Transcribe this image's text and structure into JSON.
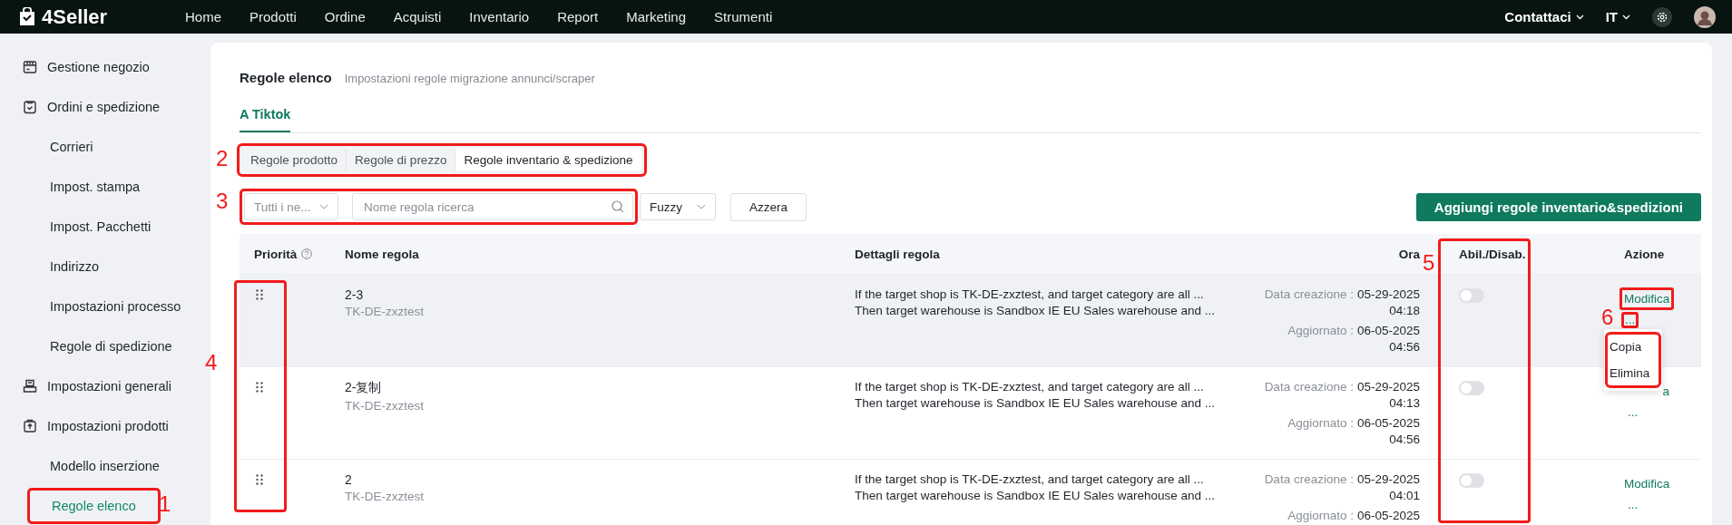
{
  "topbar": {
    "logo": "4Seller",
    "nav": [
      "Home",
      "Prodotti",
      "Ordine",
      "Acquisti",
      "Inventario",
      "Report",
      "Marketing",
      "Strumenti"
    ],
    "contact": "Contattaci",
    "language": "IT"
  },
  "sidebar": {
    "items": [
      {
        "label": "Gestione negozio",
        "kind": "section",
        "selected": false
      },
      {
        "label": "Ordini e spedizione",
        "kind": "section",
        "selected": false
      },
      {
        "label": "Corrieri",
        "kind": "link",
        "selected": false
      },
      {
        "label": "Impost. stampa",
        "kind": "link",
        "selected": false
      },
      {
        "label": "Impost. Pacchetti",
        "kind": "link",
        "selected": false
      },
      {
        "label": "Indirizzo",
        "kind": "link",
        "selected": false
      },
      {
        "label": "Impostazioni processo",
        "kind": "link",
        "selected": false
      },
      {
        "label": "Regole di spedizione",
        "kind": "link",
        "selected": false
      },
      {
        "label": "Impostazioni generali",
        "kind": "section",
        "selected": false
      },
      {
        "label": "Impostazioni prodotti",
        "kind": "section",
        "selected": false
      },
      {
        "label": "Modello inserzione",
        "kind": "link",
        "selected": false
      },
      {
        "label": "Regole elenco",
        "kind": "link",
        "selected": true,
        "annotation": "1"
      }
    ]
  },
  "page": {
    "title": "Regole elenco",
    "subtitle": "Impostazioni regole migrazione annunci/scraper"
  },
  "tabs": [
    {
      "label": "A Tiktok",
      "selected": true
    }
  ],
  "subtabs": {
    "annotation": "2",
    "items": [
      {
        "label": "Regole prodotto",
        "selected": false
      },
      {
        "label": "Regole di prezzo",
        "selected": false
      },
      {
        "label": "Regole inventario & spedizione",
        "selected": true
      }
    ]
  },
  "filters": {
    "annotation": "3",
    "shop_select": "Tutti i ne...",
    "search": {
      "placeholder": "Nome regola ricerca"
    },
    "match_select": "Fuzzy",
    "reset_button": "Azzera"
  },
  "add_button": "Aggiungi regole inventario&spedizioni",
  "table": {
    "columns": [
      "Priorità",
      "Nome regola",
      "Dettagli regola",
      "Ora",
      "Abil./Disab.",
      "Azione"
    ],
    "priority_annotation": "4",
    "toggle_annotation": "5",
    "rows": [
      {
        "name": "2-3",
        "shop": "TK-DE-zxztest",
        "details": [
          "If the target shop is TK-DE-zxztest, and target category are all ...",
          "Then target warehouse is Sandbox IE EU Sales warehouse and ..."
        ],
        "created_label": "Data creazione :",
        "created_date": "05-29-2025",
        "created_time": "04:18",
        "updated_label": "Aggiornato :",
        "updated_date": "06-05-2025",
        "updated_time": "04:56",
        "enabled": false,
        "hovered": true,
        "action": "Modifica",
        "action_highlighted": true,
        "more": "...",
        "more_annotation": "6",
        "menu": {
          "highlighted": true,
          "items": [
            "Copia",
            "Elimina"
          ]
        }
      },
      {
        "name": "2-复制",
        "shop": "TK-DE-zxztest",
        "details": [
          "If the target shop is TK-DE-zxztest, and target category are all ...",
          "Then target warehouse is Sandbox IE EU Sales warehouse and ..."
        ],
        "created_label": "Data creazione :",
        "created_date": "05-29-2025",
        "created_time": "04:13",
        "updated_label": "Aggiornato :",
        "updated_date": "06-05-2025",
        "updated_time": "04:56",
        "enabled": false,
        "hovered": false,
        "action": "a",
        "action_highlighted": false,
        "more": "..."
      },
      {
        "name": "2",
        "shop": "TK-DE-zxztest",
        "details": [
          "If the target shop is TK-DE-zxztest, and target category are all ...",
          "Then target warehouse is Sandbox IE EU Sales warehouse and ..."
        ],
        "created_label": "Data creazione :",
        "created_date": "05-29-2025",
        "created_time": "04:01",
        "updated_label": "Aggiornato :",
        "updated_date": "06-05-2025",
        "enabled": false,
        "hovered": false,
        "action": "Modifica",
        "action_highlighted": false,
        "more": "..."
      }
    ]
  }
}
